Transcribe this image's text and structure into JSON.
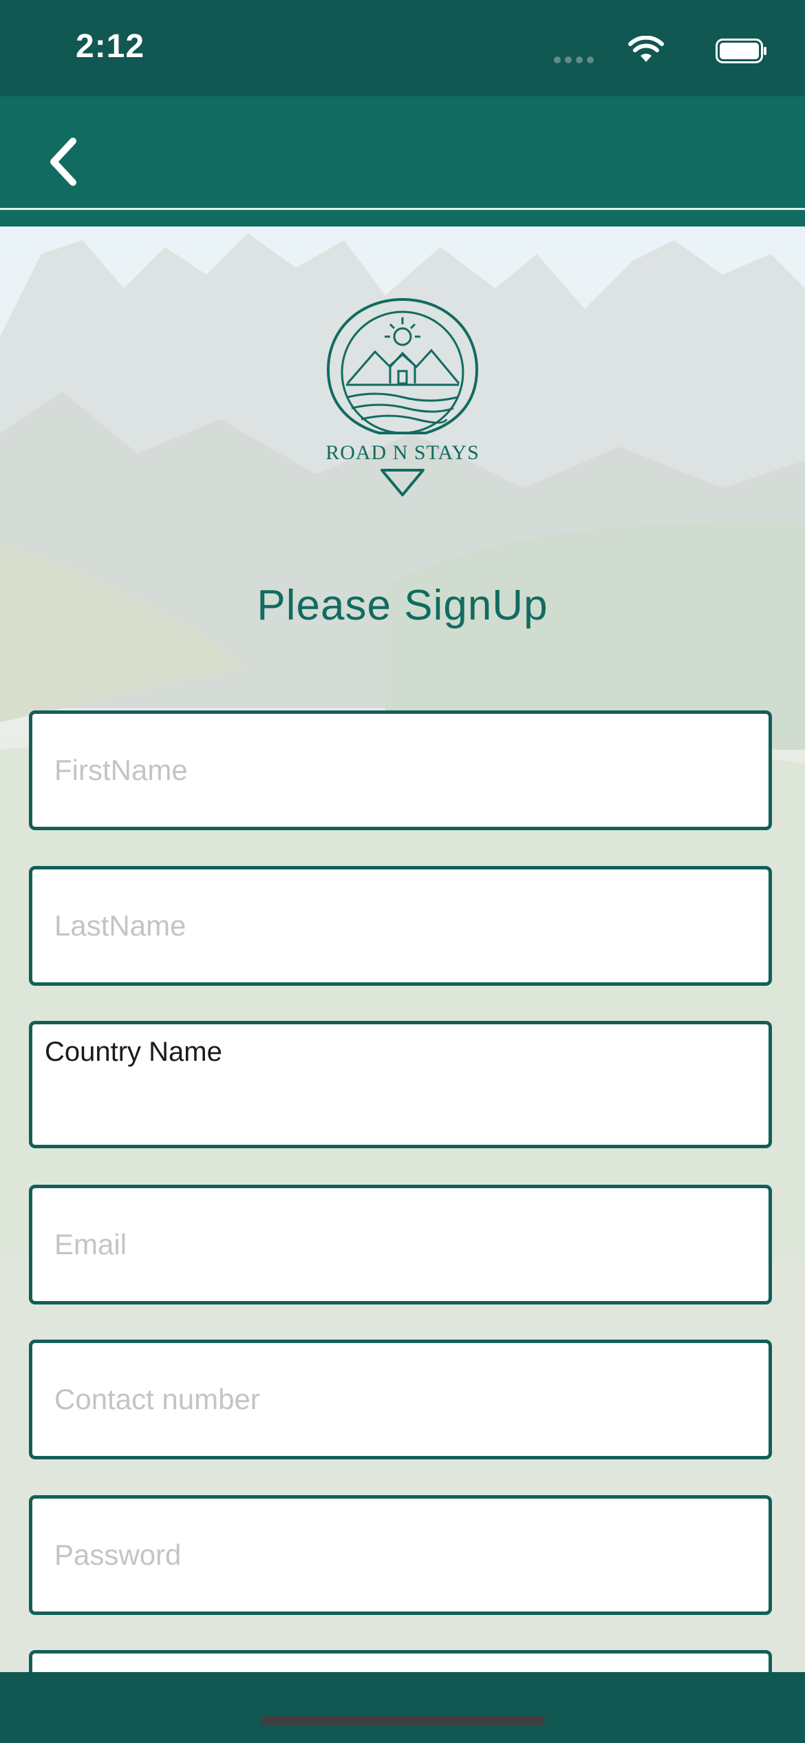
{
  "status_bar": {
    "time": "2:12",
    "icons": [
      "signal-dots-icon",
      "wifi-icon",
      "battery-icon"
    ]
  },
  "nav": {
    "back_icon": "chevron-left-icon"
  },
  "brand": {
    "logo_text": "ROAD N STAYS"
  },
  "page": {
    "title": "Please SignUp"
  },
  "form": {
    "first_name": {
      "placeholder": "FirstName",
      "value": ""
    },
    "last_name": {
      "placeholder": "LastName",
      "value": ""
    },
    "country": {
      "value": "Country Name"
    },
    "email": {
      "placeholder": "Email",
      "value": ""
    },
    "contact": {
      "placeholder": "Contact number",
      "value": ""
    },
    "password": {
      "placeholder": "Password",
      "value": ""
    }
  },
  "colors": {
    "primary": "#116b60",
    "status_bar": "#115752",
    "field_border": "#116058"
  }
}
